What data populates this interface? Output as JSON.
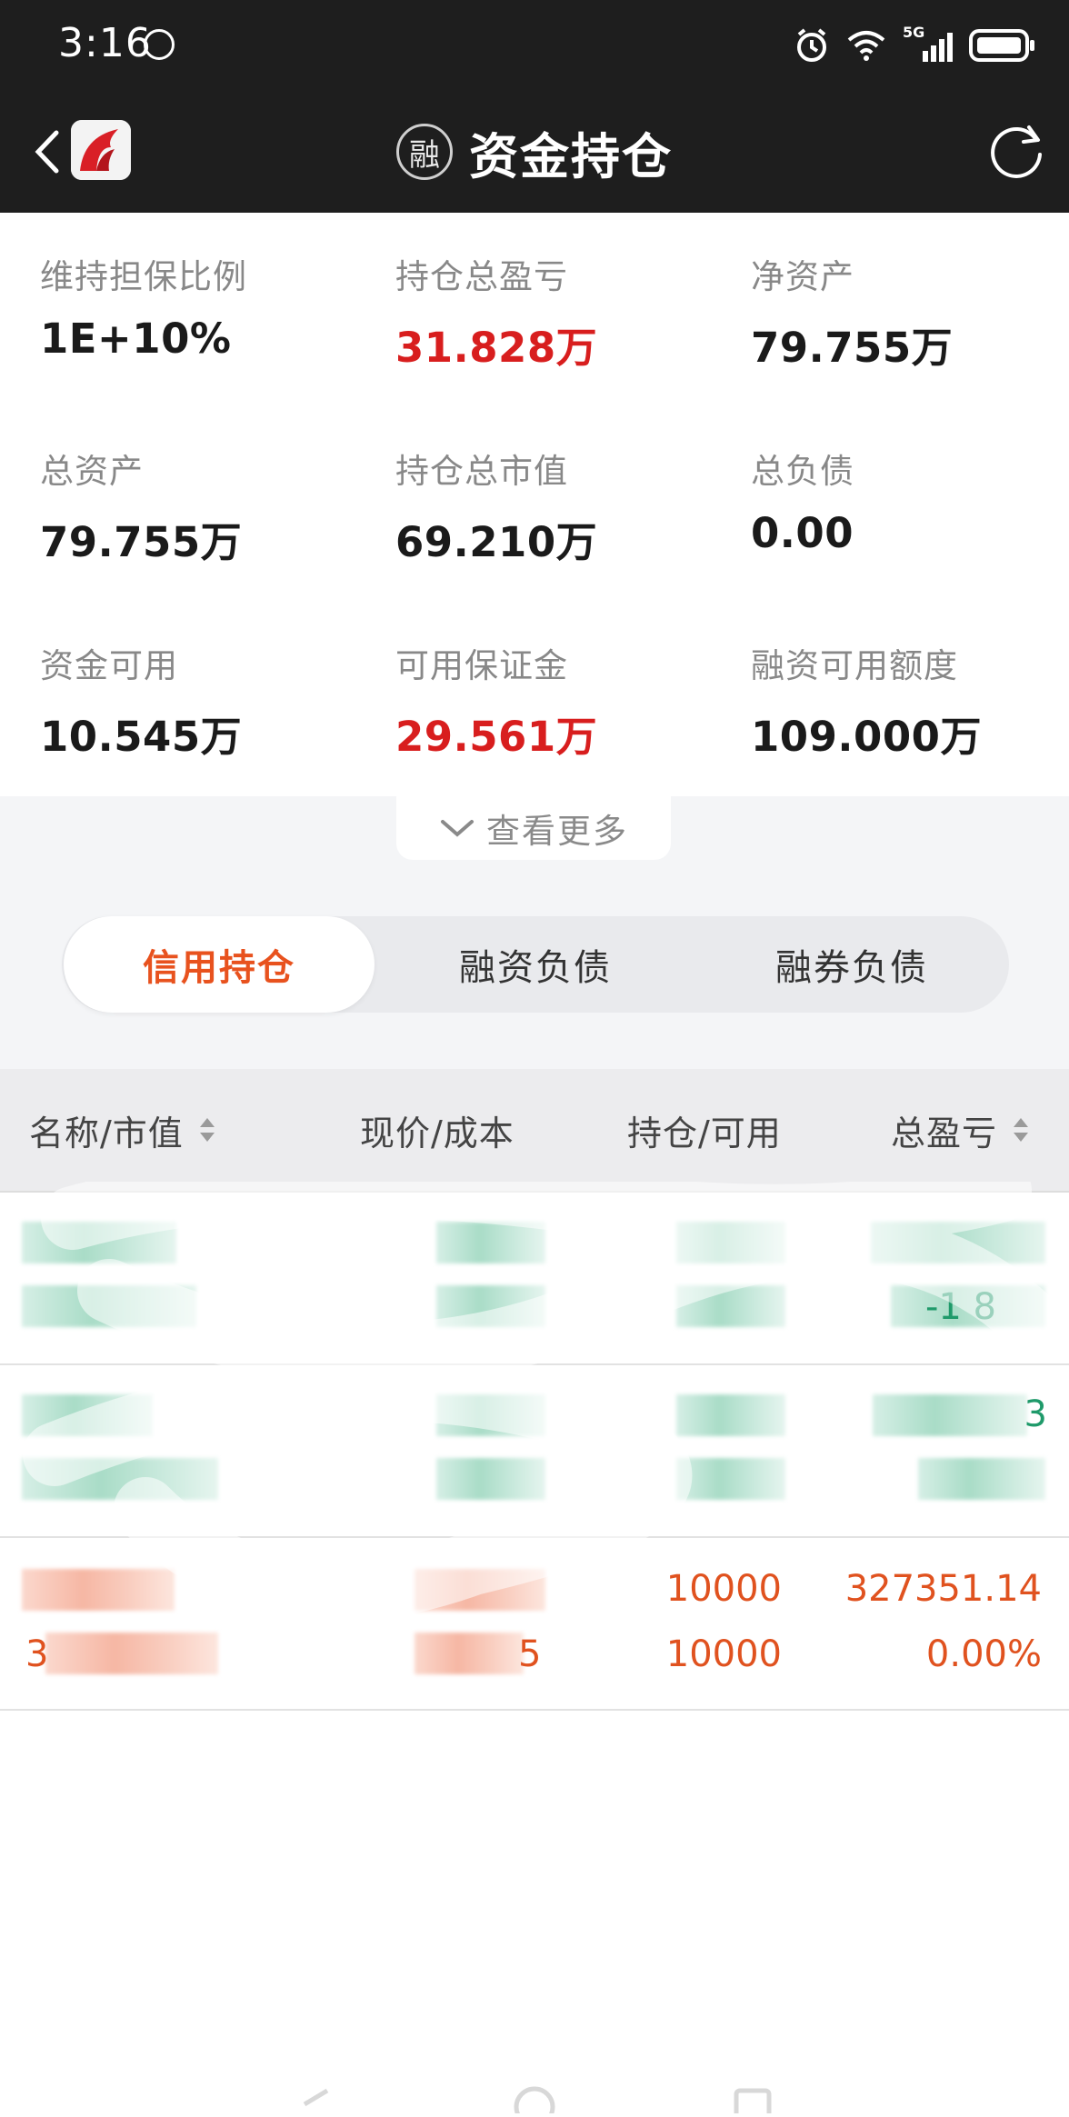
{
  "status_bar": {
    "time": "3:16",
    "network": "5G"
  },
  "header": {
    "title": "资金持仓",
    "badge": "融"
  },
  "summary": [
    {
      "label": "维持担保比例",
      "value": "1E+10%",
      "highlight": false
    },
    {
      "label": "持仓总盈亏",
      "value": "31.828万",
      "highlight": true
    },
    {
      "label": "净资产",
      "value": "79.755万",
      "highlight": false
    },
    {
      "label": "总资产",
      "value": "79.755万",
      "highlight": false
    },
    {
      "label": "持仓总市值",
      "value": "69.210万",
      "highlight": false
    },
    {
      "label": "总负债",
      "value": "0.00",
      "highlight": false
    },
    {
      "label": "资金可用",
      "value": "10.545万",
      "highlight": false
    },
    {
      "label": "可用保证金",
      "value": "29.561万",
      "highlight": true
    },
    {
      "label": "融资可用额度",
      "value": "109.000万",
      "highlight": false
    }
  ],
  "more_label": "查看更多",
  "tabs": [
    {
      "label": "信用持仓",
      "active": true
    },
    {
      "label": "融资负债",
      "active": false
    },
    {
      "label": "融券负债",
      "active": false
    }
  ],
  "table": {
    "headers": [
      "名称/市值",
      "现价/成本",
      "持仓/可用",
      "总盈亏"
    ],
    "rows": [
      {
        "visible": {
          "col4_line2": "-1 8"
        }
      },
      {
        "visible": {
          "col4_line1": "3"
        }
      },
      {
        "visible": {
          "col1_line2": "3",
          "col3_line1": "10000",
          "col3_line2": "10000",
          "col4_line1": "327351.14",
          "col4_line2": "0.00%",
          "col2_line2": "5"
        }
      }
    ]
  },
  "colors": {
    "accent": "#e8521e",
    "profit_red": "#d81e1e",
    "loss_green": "#1f9a6a",
    "header_bg": "#1e1e1e"
  }
}
